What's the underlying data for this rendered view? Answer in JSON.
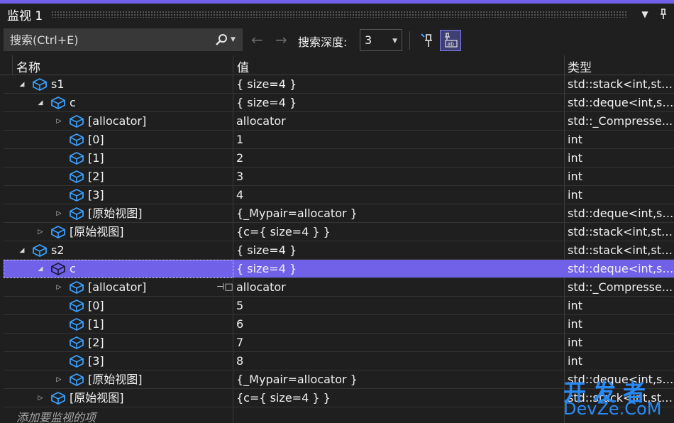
{
  "window": {
    "title": "监视 1",
    "dropdown_icon": "chevron-down-icon",
    "pin_icon": "pin-icon"
  },
  "toolbar": {
    "search_placeholder": "搜索(Ctrl+E)",
    "depth_label": "搜索深度:",
    "depth_value": "3"
  },
  "columns": {
    "name": "名称",
    "value": "值",
    "type": "类型"
  },
  "rows": [
    {
      "level": 0,
      "expander": "expanded",
      "name": "s1",
      "value": "{ size=4 }",
      "type": "std::stack<int,std::..."
    },
    {
      "level": 1,
      "expander": "expanded",
      "name": "c",
      "value": "{ size=4 }",
      "type": "std::deque<int,st..."
    },
    {
      "level": 2,
      "expander": "collapsed",
      "name": "[allocator]",
      "value": "allocator",
      "type": "std::_Compresse..."
    },
    {
      "level": 2,
      "expander": "none",
      "name": "[0]",
      "value": "1",
      "type": "int"
    },
    {
      "level": 2,
      "expander": "none",
      "name": "[1]",
      "value": "2",
      "type": "int"
    },
    {
      "level": 2,
      "expander": "none",
      "name": "[2]",
      "value": "3",
      "type": "int"
    },
    {
      "level": 2,
      "expander": "none",
      "name": "[3]",
      "value": "4",
      "type": "int"
    },
    {
      "level": 2,
      "expander": "collapsed",
      "name": "[原始视图]",
      "value": "{_Mypair=allocator }",
      "type": "std::deque<int,st..."
    },
    {
      "level": 1,
      "expander": "collapsed",
      "name": "[原始视图]",
      "value": "{c={ size=4 } }",
      "type": "std::stack<int,std:..."
    },
    {
      "level": 0,
      "expander": "expanded",
      "name": "s2",
      "value": "{ size=4 }",
      "type": "std::stack<int,std:..."
    },
    {
      "level": 1,
      "expander": "expanded",
      "name": "c",
      "value": "{ size=4 }",
      "type": "std::deque<int,st...",
      "selected": true
    },
    {
      "level": 2,
      "expander": "collapsed",
      "name": "[allocator]",
      "value": "allocator",
      "type": "std::_Compresse...",
      "pinned": true
    },
    {
      "level": 2,
      "expander": "none",
      "name": "[0]",
      "value": "5",
      "type": "int"
    },
    {
      "level": 2,
      "expander": "none",
      "name": "[1]",
      "value": "6",
      "type": "int"
    },
    {
      "level": 2,
      "expander": "none",
      "name": "[2]",
      "value": "7",
      "type": "int"
    },
    {
      "level": 2,
      "expander": "none",
      "name": "[3]",
      "value": "8",
      "type": "int"
    },
    {
      "level": 2,
      "expander": "collapsed",
      "name": "[原始视图]",
      "value": "{_Mypair=allocator }",
      "type": "std::deque<int,st..."
    },
    {
      "level": 1,
      "expander": "collapsed",
      "name": "[原始视图]",
      "value": "{c={ size=4 } }",
      "type": "std::stack<int,std:..."
    }
  ],
  "add_item_placeholder": "添加要监视的项",
  "watermark": {
    "line1": "开发者",
    "line2": "DevZe.CoM"
  },
  "colors": {
    "accent": "#7160e8",
    "background": "#1f1f1f",
    "icon": "#3aa0ff"
  }
}
